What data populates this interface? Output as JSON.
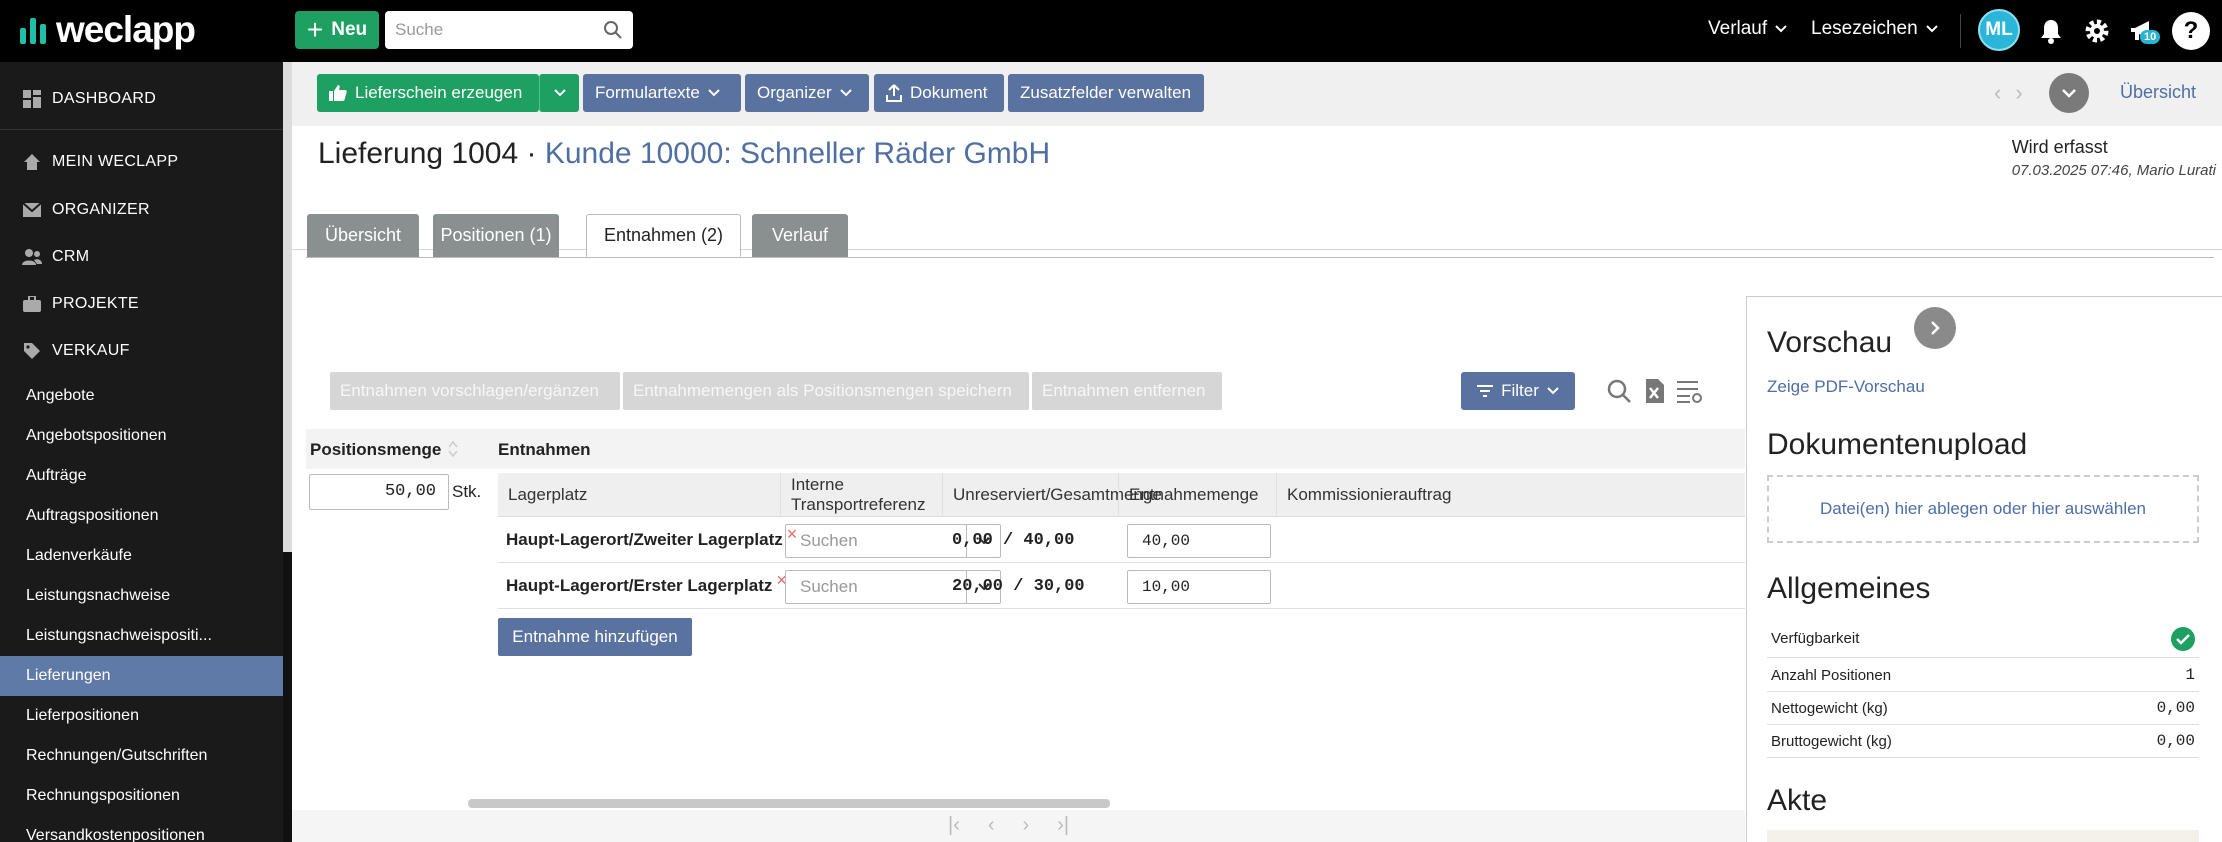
{
  "topbar": {
    "logo": "weclapp",
    "new_label": "Neu",
    "search_placeholder": "Suche",
    "verlauf": "Verlauf",
    "lesezeichen": "Lesezeichen",
    "avatar": "ML",
    "notif_count": "10",
    "help": "?"
  },
  "sidebar": {
    "main": [
      {
        "label": "DASHBOARD",
        "icon": "dashboard-icon"
      },
      {
        "label": "MEIN WECLAPP",
        "icon": "home-icon"
      },
      {
        "label": "ORGANIZER",
        "icon": "mail-icon"
      },
      {
        "label": "CRM",
        "icon": "users-icon"
      },
      {
        "label": "PROJEKTE",
        "icon": "briefcase-icon"
      },
      {
        "label": "VERKAUF",
        "icon": "tag-icon"
      }
    ],
    "sub": [
      "Angebote",
      "Angebotspositionen",
      "Aufträge",
      "Auftragspositionen",
      "Ladenverkäufe",
      "Leistungsnachweise",
      "Leistungsnachweispositi...",
      "Lieferungen",
      "Lieferpositionen",
      "Rechnungen/Gutschriften",
      "Rechnungspositionen",
      "Versandkostenpositionen"
    ],
    "active_sub": "Lieferungen"
  },
  "toolbar": {
    "lieferschein": "Lieferschein erzeugen",
    "formulartexte": "Formulartexte",
    "organizer": "Organizer",
    "dokument": "Dokument",
    "zusatzfelder": "Zusatzfelder verwalten",
    "ubersicht": "Übersicht"
  },
  "header": {
    "title_prefix": "Lieferung 1004 ·",
    "customer": "Kunde 10000: Schneller Räder GmbH",
    "status": "Wird erfasst",
    "status_meta": "07.03.2025 07:46, Mario Lurati"
  },
  "tabs": [
    {
      "label": "Übersicht",
      "active": false
    },
    {
      "label": "Positionen (1)",
      "active": false
    },
    {
      "label": "Entnahmen (2)",
      "active": true
    },
    {
      "label": "Verlauf",
      "active": false
    }
  ],
  "actions": {
    "vorschlagen": "Entnahmen vorschlagen/ergänzen",
    "speichern": "Entnahmemengen als Positionsmengen speichern",
    "entfernen": "Entnahmen entfernen",
    "filter": "Filter"
  },
  "grid": {
    "col_positionsmenge": "Positionsmenge",
    "col_entnahmen": "Entnahmen",
    "position_qty": "50,00",
    "unit": "Stk.",
    "sub_headers": [
      "Lagerplatz",
      "Interne Transportreferenz",
      "Unreserviert/Gesamtmenge",
      "Entnahmemenge",
      "Kommissionierauftrag"
    ],
    "rows": [
      {
        "lagerplatz": "Haupt-Lagerort/Zweiter Lagerplatz",
        "transport_placeholder": "Suchen",
        "menge": "0,00 / 40,00",
        "entnahme": "40,00"
      },
      {
        "lagerplatz": "Haupt-Lagerort/Erster Lagerplatz",
        "transport_placeholder": "Suchen",
        "menge": "20,00 / 30,00",
        "entnahme": "10,00"
      }
    ],
    "remove_symbol": "×",
    "add_button": "Entnahme hinzufügen"
  },
  "panel": {
    "vorschau": "Vorschau",
    "pdf_link": "Zeige PDF-Vorschau",
    "upload_title": "Dokumentenupload",
    "dropzone": "Datei(en) hier ablegen oder hier auswählen",
    "allgemeines": "Allgemeines",
    "rows": [
      {
        "label": "Verfügbarkeit",
        "value": ""
      },
      {
        "label": "Anzahl Positionen",
        "value": "1"
      },
      {
        "label": "Nettogewicht (kg)",
        "value": "0,00"
      },
      {
        "label": "Bruttogewicht (kg)",
        "value": "0,00"
      }
    ],
    "akte": "Akte"
  },
  "colors": {
    "accent": "#5a72a0",
    "green": "#1ea062",
    "sidebar_active": "#5f7aa6"
  }
}
